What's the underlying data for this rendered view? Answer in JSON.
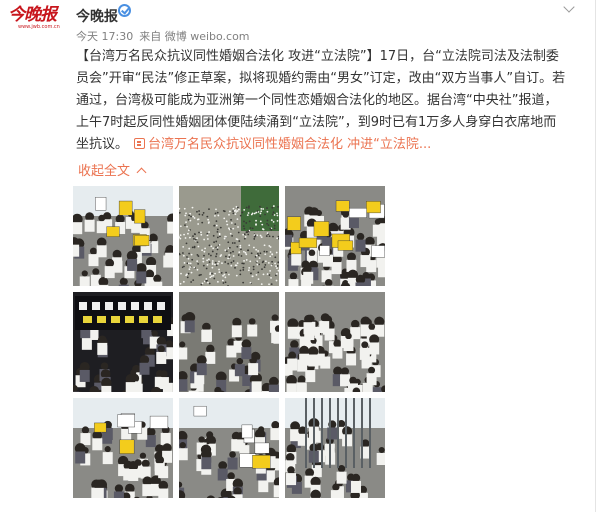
{
  "header": {
    "avatar_logo": "今晚报",
    "avatar_url": "www.jwb.com.cn",
    "user_name": "今晚报",
    "verified_icon": "verified-badge-icon",
    "menu_icon": "chevron-down-icon"
  },
  "meta": {
    "time": "今天 17:30",
    "source": "来自 微博 weibo.com"
  },
  "post": {
    "text": "【台湾万名民众抗议同性婚姻合法化 攻进“立法院”】17日，台“立法院司法及法制委员会”开审“民法”修正草案，拟将现婚约需由“男女”订定，改由“双方当事人”自订。若通过，台湾极可能成为亚洲第一个同性恋婚姻合法化的地区。据台湾“中央社”报道，上午7时起反同性婚姻团体便陆续涌到“立法院”，到9时已有1万多人身穿白衣席地而坐抗议。",
    "link_text": "台湾万名民众抗议同性婚姻合法化 冲进“立法院...",
    "link_icon": "link-icon",
    "collapse_label": "收起全文",
    "collapse_icon": "chevron-up-icon"
  },
  "photos": [
    {
      "name": "photo-protest-signs",
      "theme": "signs"
    },
    {
      "name": "photo-aerial-crowd",
      "theme": "aerial"
    },
    {
      "name": "photo-crowd-banners",
      "theme": "banners"
    },
    {
      "name": "photo-banner-speakers",
      "theme": "speaker"
    },
    {
      "name": "photo-kneeling-protesters",
      "theme": "kneel"
    },
    {
      "name": "photo-crowd-fence",
      "theme": "crowd"
    },
    {
      "name": "photo-crowd-signs-street",
      "theme": "street"
    },
    {
      "name": "photo-police-clash",
      "theme": "clash"
    },
    {
      "name": "photo-gate-push",
      "theme": "gate"
    }
  ],
  "colors": {
    "accent": "#eb7350",
    "brand": "#c8161d",
    "verified": "#4a90e2"
  }
}
